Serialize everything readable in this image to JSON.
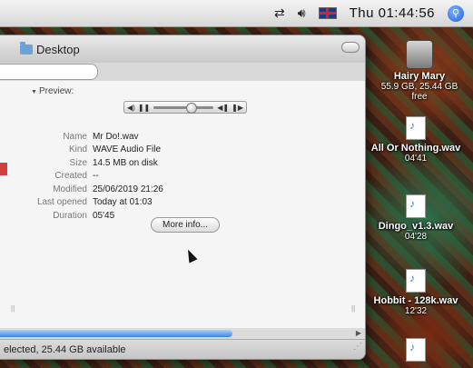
{
  "menubar": {
    "clock": "Thu 01:44:56"
  },
  "window": {
    "title": "Desktop",
    "preview_label": "Preview:",
    "info": [
      {
        "label": "Name",
        "value": "Mr Do!.wav"
      },
      {
        "label": "Kind",
        "value": "WAVE Audio File"
      },
      {
        "label": "Size",
        "value": "14.5 MB on disk"
      },
      {
        "label": "Created",
        "value": "--"
      },
      {
        "label": "Modified",
        "value": "25/06/2019 21:26"
      },
      {
        "label": "Last opened",
        "value": "Today at 01:03"
      },
      {
        "label": "Duration",
        "value": "05'45"
      }
    ],
    "more_info_label": "More info...",
    "status_text": "elected, 25.44 GB available"
  },
  "desktop": {
    "icons": [
      {
        "name": "Hairy Mary",
        "sub": "55.9 GB, 25.44 GB free",
        "icon": "hard-drive-icon"
      },
      {
        "name": "All Or Nothing.wav",
        "sub": "04'41",
        "icon": "wav-file-icon"
      },
      {
        "name": "Dingo_v1.3.wav",
        "sub": "04'28",
        "icon": "wav-file-icon"
      },
      {
        "name": "Hobbit - 128k.wav",
        "sub": "12'32",
        "icon": "wav-file-icon"
      }
    ]
  }
}
